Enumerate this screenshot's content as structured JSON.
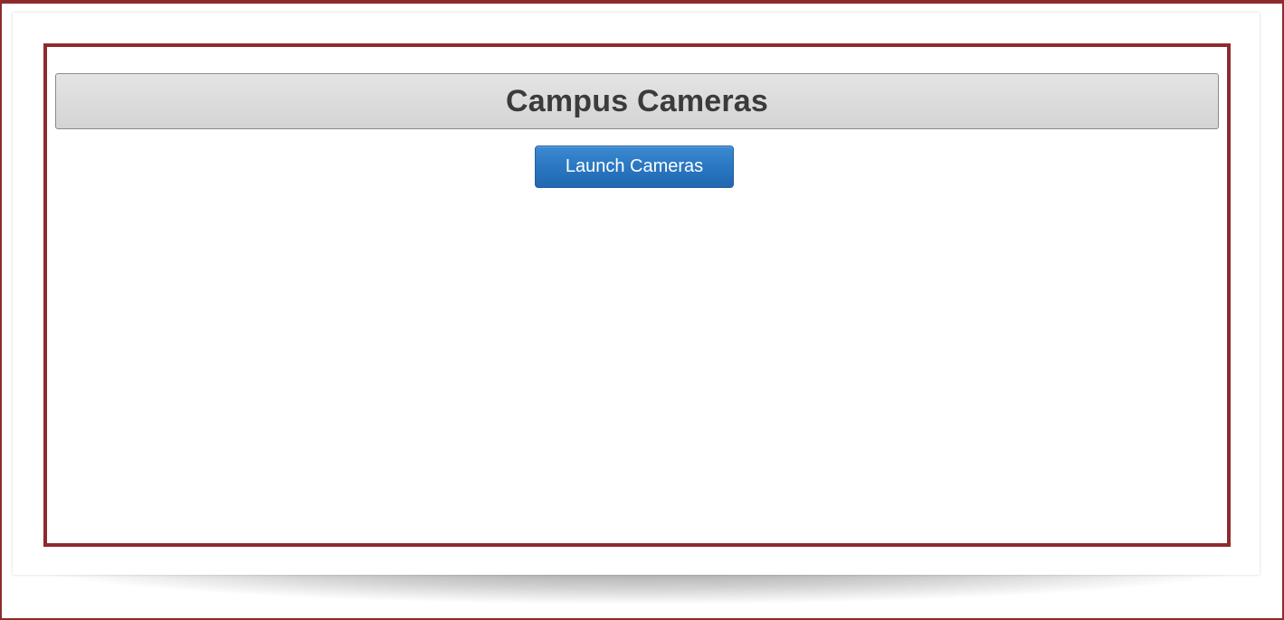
{
  "page": {
    "title": "Campus Cameras"
  },
  "actions": {
    "launch_label": "Launch Cameras"
  },
  "colors": {
    "frame_border": "#8e2a2e",
    "header_background": "#d8d8d8",
    "title_text": "#3b3b3b",
    "button_background": "#2a77c1",
    "button_text": "#ffffff"
  }
}
